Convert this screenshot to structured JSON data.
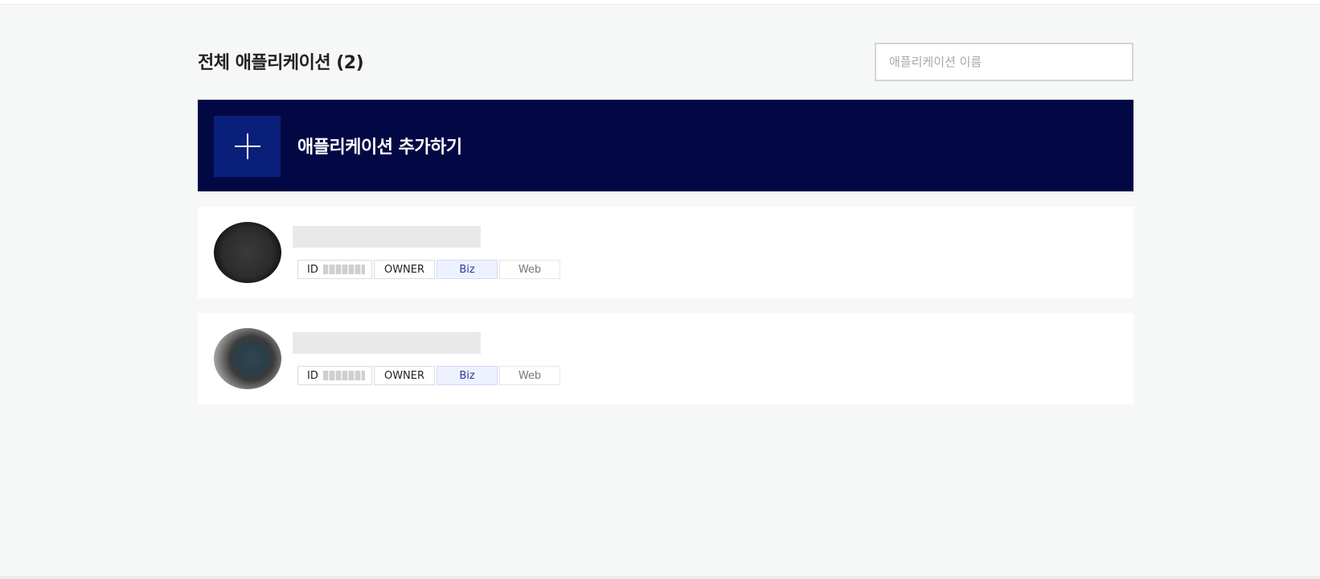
{
  "header": {
    "title": "전체 애플리케이션 (2)"
  },
  "search": {
    "placeholder": "애플리케이션 이름",
    "value": ""
  },
  "add_banner": {
    "label": "애플리케이션 추가하기",
    "icon": "plus-icon"
  },
  "apps": [
    {
      "avatar": "app-avatar",
      "tags": {
        "id_label": "ID",
        "role": "OWNER",
        "plan": "Biz",
        "platform": "Web"
      }
    },
    {
      "avatar": "app-avatar",
      "tags": {
        "id_label": "ID",
        "role": "OWNER",
        "plan": "Biz",
        "platform": "Web"
      }
    }
  ],
  "colors": {
    "banner_bg": "#020844",
    "banner_icon_bg": "#0a1f7a",
    "biz_tag_text": "#2a3a9c",
    "page_bg": "#f6f7f7"
  }
}
